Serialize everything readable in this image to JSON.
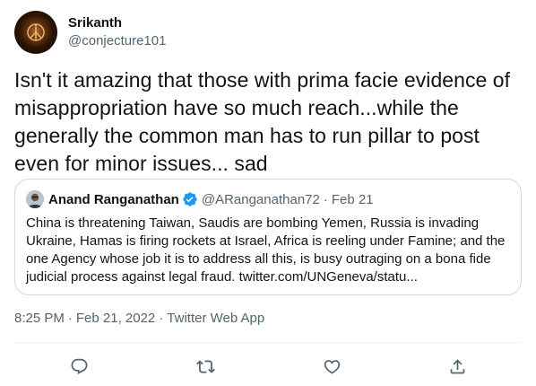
{
  "tweet": {
    "author": {
      "display_name": "Srikanth",
      "handle": "@conjecture101"
    },
    "text": "Isn't it amazing that those with prima facie evidence of misappropriation have so much reach...while the generally the common man has to run pillar to post even for minor issues... sad",
    "quoted": {
      "display_name": "Anand Ranganathan",
      "handle": "@ARanganathan72",
      "separator": "·",
      "date": "Feb 21",
      "verified": true,
      "text": "China is threatening Taiwan, Saudis are bombing Yemen, Russia is invading Ukraine, Hamas is firing rockets at Israel, Africa is reeling under Famine; and the one Agency whose job it is to address all this, is busy outraging on a bona fide judicial process against legal fraud. twitter.com/UNGeneva/statu..."
    },
    "meta": {
      "time": "8:25 PM",
      "separator": "·",
      "date": "Feb 21, 2022",
      "source": "Twitter Web App"
    }
  },
  "actions": [
    {
      "name": "reply",
      "icon": "reply-icon"
    },
    {
      "name": "retweet",
      "icon": "retweet-icon"
    },
    {
      "name": "like",
      "icon": "heart-icon"
    },
    {
      "name": "share",
      "icon": "share-icon"
    }
  ],
  "colors": {
    "primary_text": "#0f1419",
    "secondary_text": "#536471",
    "verified_blue": "#1d9bf0",
    "border": "#cfd9de"
  }
}
